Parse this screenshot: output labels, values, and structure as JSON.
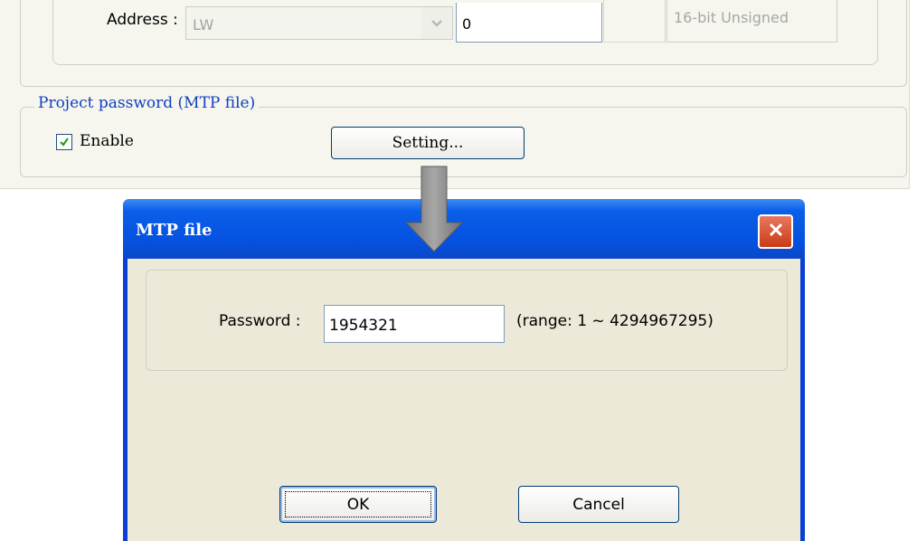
{
  "parent_dialog": {
    "address": {
      "label": "Address :",
      "device": "LW",
      "value": "0",
      "data_type": "16-bit Unsigned"
    },
    "project_password_group": {
      "title": "Project password (MTP file)",
      "enable_label": "Enable",
      "enable_checked": true,
      "setting_button": "Setting..."
    }
  },
  "arrow": {
    "meaning": "points-down-from-setting-to-dialog",
    "color": "#8a8a8a"
  },
  "mtp_dialog": {
    "title": "MTP file",
    "password_label": "Password :",
    "password_value": "1954321",
    "range_text": "(range: 1 ~ 4294967295)",
    "ok_label": "OK",
    "cancel_label": "Cancel"
  },
  "colors": {
    "titlebar": "#0552e0",
    "group_title": "#1040c0",
    "close_button": "#d9532f",
    "dialog_body": "#ece9d8"
  }
}
